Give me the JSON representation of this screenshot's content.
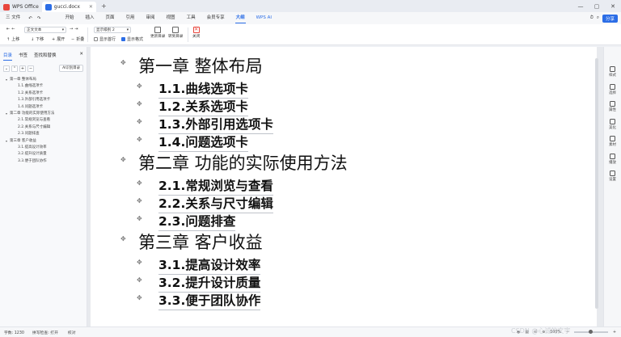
{
  "titlebar": {
    "tabs": [
      "WPS Office",
      "gucci.docx"
    ],
    "new_tab": "+",
    "controls": [
      "—",
      "▢",
      "✕"
    ]
  },
  "menubar": {
    "file": "三 文件",
    "items": [
      "开始",
      "插入",
      "页面",
      "引用",
      "审阅",
      "视图",
      "工具",
      "会员专享",
      "大纲",
      "WPS AI"
    ],
    "active": "大纲",
    "share": "分享"
  },
  "ribbon": {
    "style_select": "正文文本",
    "level_select": "显示级别 2",
    "up": "上移",
    "down": "下移",
    "expand": "展开",
    "collapse": "折叠",
    "show_first_line": "显示首行",
    "show_format": "显示格式",
    "update_toc": "更新目录",
    "goto_toc": "转到目录",
    "close": "关闭"
  },
  "left_panel": {
    "tabs": [
      "目录",
      "书签",
      "查找和替换"
    ],
    "ai_button": "AI识别目录",
    "items": [
      {
        "label": "第一章 整体布局",
        "level": 1
      },
      {
        "label": "1.1.曲线选项卡",
        "level": 2
      },
      {
        "label": "1.2.关系选项卡",
        "level": 2
      },
      {
        "label": "1.3.外部引用选项卡",
        "level": 2
      },
      {
        "label": "1.4.问题选项卡",
        "level": 2
      },
      {
        "label": "第二章 功能的实际使用方法",
        "level": 1
      },
      {
        "label": "2.1.常规浏览与查看",
        "level": 2
      },
      {
        "label": "2.2.关系与尺寸编辑",
        "level": 2
      },
      {
        "label": "2.3.问题排查",
        "level": 2
      },
      {
        "label": "第三章 客户收益",
        "level": 1
      },
      {
        "label": "3.1.提高设计效率",
        "level": 2
      },
      {
        "label": "3.2.提升设计质量",
        "level": 2
      },
      {
        "label": "3.3.便于团队协作",
        "level": 2
      }
    ]
  },
  "document": {
    "headings": [
      {
        "text": "第一章 整体布局",
        "level": 1
      },
      {
        "text": "1.1.曲线选项卡",
        "level": 2
      },
      {
        "text": "1.2.关系选项卡",
        "level": 2
      },
      {
        "text": "1.3.外部引用选项卡",
        "level": 2
      },
      {
        "text": "1.4.问题选项卡",
        "level": 2
      },
      {
        "text": "第二章 功能的实际使用方法",
        "level": 1
      },
      {
        "text": "2.1.常规浏览与查看",
        "level": 2
      },
      {
        "text": "2.2.关系与尺寸编辑",
        "level": 2
      },
      {
        "text": "2.3.问题排查",
        "level": 2
      },
      {
        "text": "第三章 客户收益",
        "level": 1
      },
      {
        "text": "3.1.提高设计效率",
        "level": 2
      },
      {
        "text": "3.2.提升设计质量",
        "level": 2
      },
      {
        "text": "3.3.便于团队协作",
        "level": 2
      }
    ]
  },
  "right_bar": {
    "items": [
      "样式",
      "选择",
      "属性",
      "美化",
      "素材",
      "播放",
      "设置"
    ]
  },
  "statusbar": {
    "word_count": "字数: 1230",
    "spell_check": "拼写检查: 打开",
    "proofread": "校对",
    "zoom": "100%"
  },
  "watermark": "CSDN @心诚的文字",
  "colors": {
    "accent": "#2b6de6"
  }
}
